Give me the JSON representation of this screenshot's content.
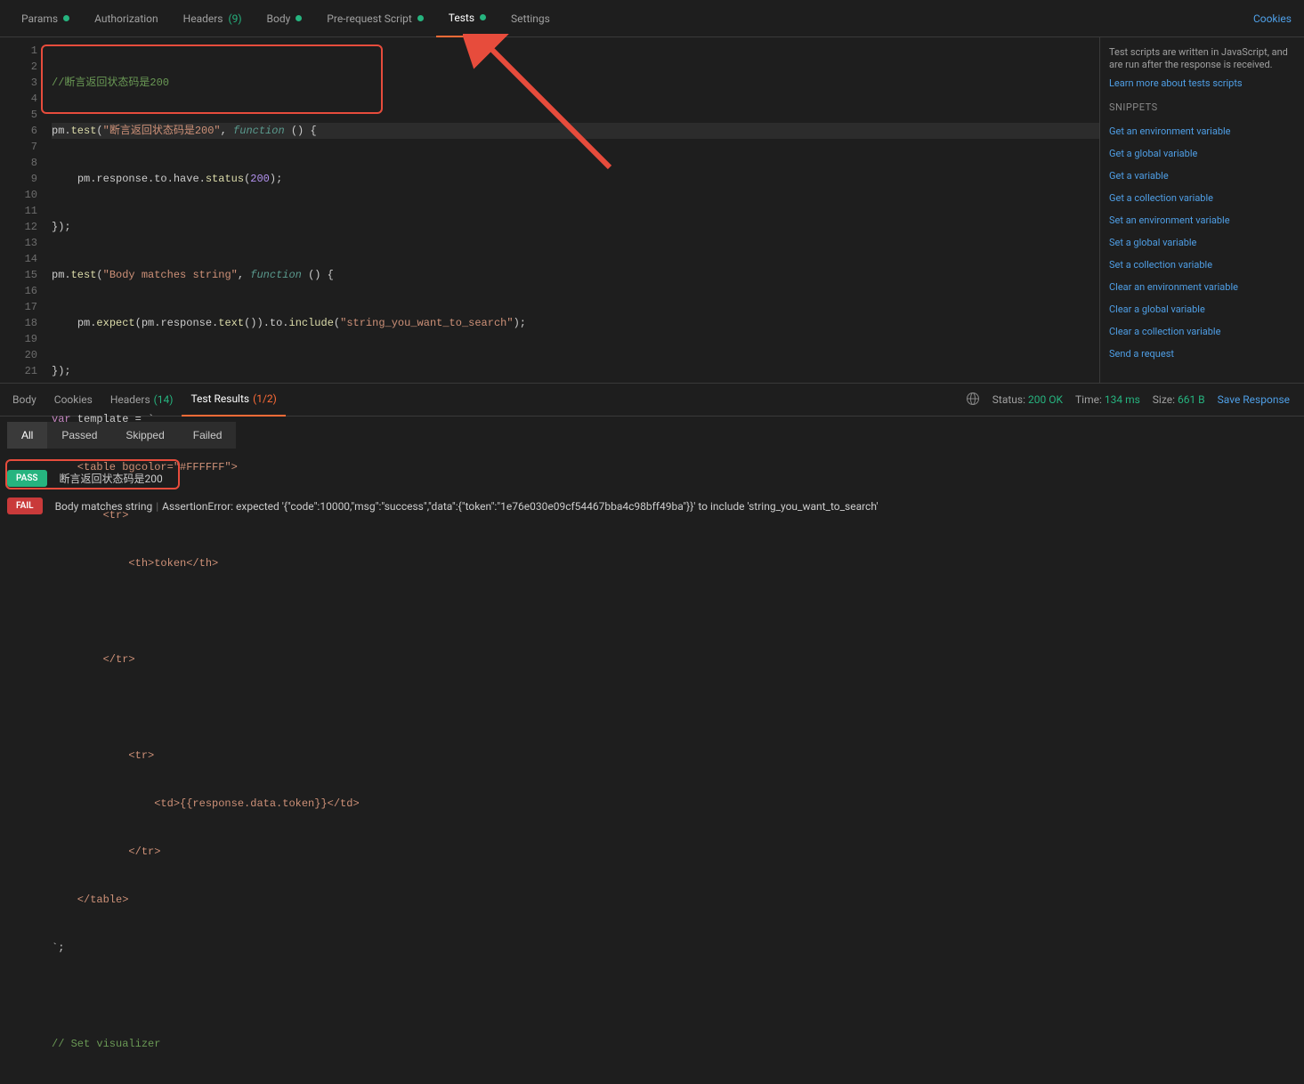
{
  "top_tabs": {
    "params": "Params",
    "auth": "Authorization",
    "headers": "Headers",
    "headers_count": "(9)",
    "body": "Body",
    "prerequest": "Pre-request Script",
    "tests": "Tests",
    "settings": "Settings",
    "cookies": "Cookies"
  },
  "editor": {
    "lines": [
      "1",
      "2",
      "3",
      "4",
      "5",
      "6",
      "7",
      "8",
      "9",
      "10",
      "11",
      "12",
      "13",
      "14",
      "15",
      "16",
      "17",
      "18",
      "19",
      "20",
      "21"
    ]
  },
  "code": {
    "l1_comment": "//断言返回状态码是200",
    "l2_pm": "pm",
    "l2_test": "test",
    "l2_str": "\"断言返回状态码是200\"",
    "l2_func": "function",
    "l3_pm": "pm",
    "l3_chain": ".response.to.have.",
    "l3_status": "status",
    "l3_num": "200",
    "l4": "});",
    "l5_pm": "pm",
    "l5_test": "test",
    "l5_str": "\"Body matches string\"",
    "l5_func": "function",
    "l6_pm1": "pm",
    "l6_expect": "expect",
    "l6_pm2": "pm",
    "l6_text": "text",
    "l6_to": ".to.",
    "l6_include": "include",
    "l6_str": "\"string_you_want_to_search\"",
    "l7": "});",
    "l8_var": "var",
    "l8_rest": " template = `",
    "l9": "    <table bgcolor=\"#FFFFFF\">",
    "l10": "        <tr>",
    "l11": "            <th>token</th>",
    "l12": "",
    "l13": "        </tr>",
    "l14": "",
    "l15": "            <tr>",
    "l16": "                <td>{{response.data.token}}</td>",
    "l17": "            </tr>",
    "l18": "    </table>",
    "l19": "`;",
    "l20": "",
    "l21": "// Set visualizer"
  },
  "right": {
    "desc": "Test scripts are written in JavaScript, and are run after the response is received.",
    "learn": "Learn more about tests scripts",
    "header": "SNIPPETS",
    "snips": [
      "Get an environment variable",
      "Get a global variable",
      "Get a variable",
      "Get a collection variable",
      "Set an environment variable",
      "Set a global variable",
      "Set a collection variable",
      "Clear an environment variable",
      "Clear a global variable",
      "Clear a collection variable",
      "Send a request"
    ]
  },
  "resp_tabs": {
    "body": "Body",
    "cookies": "Cookies",
    "headers": "Headers",
    "headers_count": "(14)",
    "test_results": "Test Results",
    "test_results_count": "(1/2)",
    "status_lbl": "Status:",
    "status_val": "200 OK",
    "time_lbl": "Time:",
    "time_val": "134 ms",
    "size_lbl": "Size:",
    "size_val": "661 B",
    "save": "Save Response"
  },
  "filters": {
    "all": "All",
    "passed": "Passed",
    "skipped": "Skipped",
    "failed": "Failed"
  },
  "results": {
    "pass_badge": "PASS",
    "pass_text": "断言返回状态码是200",
    "fail_badge": "FAIL",
    "fail_name": "Body matches string",
    "fail_err": "AssertionError: expected '{\"code\":10000,\"msg\":\"success\",\"data\":{\"token\":\"1e76e030e09cf54467bba4c98bff49ba\"}}' to include 'string_you_want_to_search'"
  }
}
